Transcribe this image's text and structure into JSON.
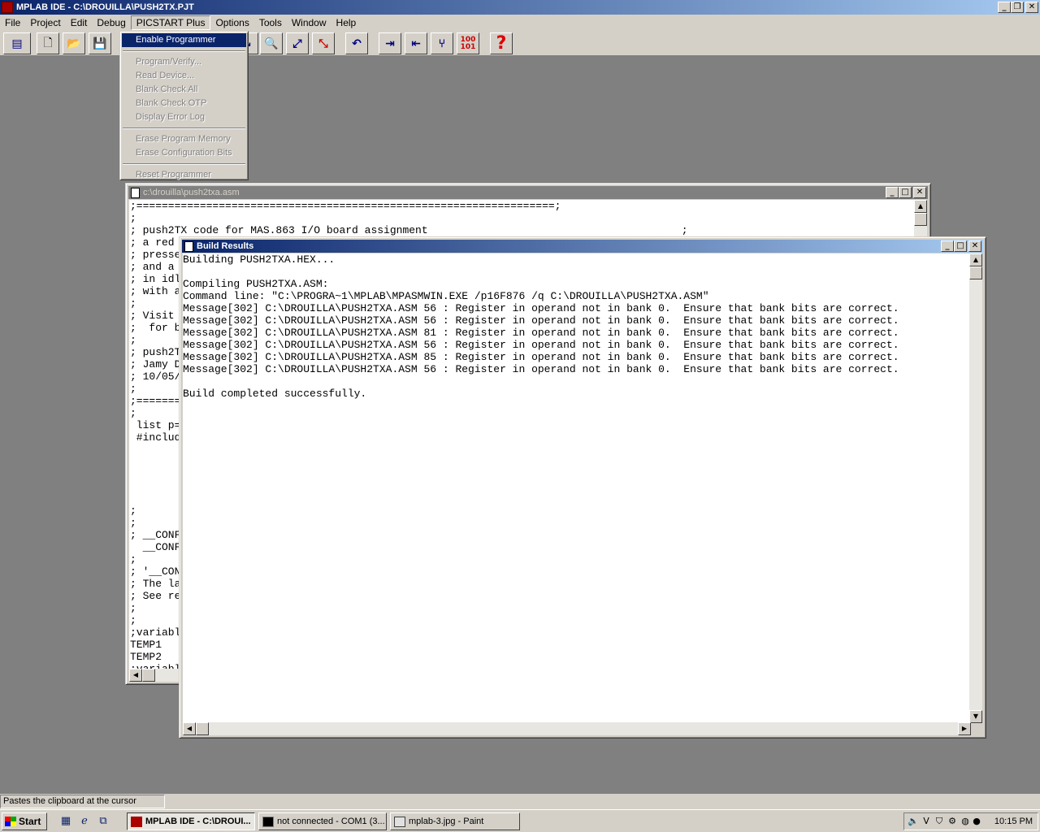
{
  "app": {
    "title": "MPLAB IDE - C:\\DROUILLA\\PUSH2TX.PJT"
  },
  "menubar": {
    "items": [
      "File",
      "Project",
      "Edit",
      "Debug",
      "PICSTART Plus",
      "Options",
      "Tools",
      "Window",
      "Help"
    ],
    "active_index": 4
  },
  "toolbar": {
    "buttons": [
      "project-icon",
      "new-file-icon",
      "open-folder-icon",
      "save-icon",
      "zoom-icon",
      "step-icon",
      "step-over-icon",
      "undo-icon",
      "indent-icon",
      "outdent-icon",
      "branch-icon",
      "hex-ascii-icon",
      "help-icon"
    ]
  },
  "picstart_menu": {
    "items": [
      {
        "label": "Enable Programmer",
        "enabled": true,
        "selected": true
      },
      {
        "separator": true
      },
      {
        "label": "Program/Verify...",
        "enabled": false
      },
      {
        "label": "Read Device...",
        "enabled": false
      },
      {
        "label": "Blank Check All",
        "enabled": false
      },
      {
        "label": "Blank Check OTP",
        "enabled": false
      },
      {
        "label": "Display Error Log",
        "enabled": false
      },
      {
        "separator": true
      },
      {
        "label": "Erase Program Memory",
        "enabled": false
      },
      {
        "label": "Erase Configuration Bits",
        "enabled": false
      },
      {
        "separator": true
      },
      {
        "label": "Reset Programmer",
        "enabled": false
      }
    ]
  },
  "editor": {
    "title": "c:\\drouilla\\push2txa.asm",
    "lines": [
      ";==================================================================;",
      ";",
      "; push2TX code for MAS.863 I/O board assignment                                        ;",
      "; a red",
      "; presse",
      "; and a",
      "; in idl",
      "; with a",
      ";",
      "; Visit",
      ";  for b",
      ";",
      "; push2T",
      "; Jamy D",
      "; 10/05/",
      ";",
      ";=======",
      ";",
      " list p=",
      " #includ",
      "",
      "",
      "",
      "",
      "",
      ";",
      ";",
      "; __CONF",
      "  __CONF",
      ";",
      "; '__CON",
      "; The la",
      "; See re",
      ";",
      ";",
      ";variabl",
      "TEMP1",
      "TEMP2",
      ";variabl"
    ]
  },
  "build_results": {
    "title": "Build Results",
    "lines": [
      "Building PUSH2TXA.HEX...",
      "",
      "Compiling PUSH2TXA.ASM:",
      "Command line: \"C:\\PROGRA~1\\MPLAB\\MPASMWIN.EXE /p16F876 /q C:\\DROUILLA\\PUSH2TXA.ASM\"",
      "Message[302] C:\\DROUILLA\\PUSH2TXA.ASM 56 : Register in operand not in bank 0.  Ensure that bank bits are correct.",
      "Message[302] C:\\DROUILLA\\PUSH2TXA.ASM 56 : Register in operand not in bank 0.  Ensure that bank bits are correct.",
      "Message[302] C:\\DROUILLA\\PUSH2TXA.ASM 81 : Register in operand not in bank 0.  Ensure that bank bits are correct.",
      "Message[302] C:\\DROUILLA\\PUSH2TXA.ASM 56 : Register in operand not in bank 0.  Ensure that bank bits are correct.",
      "Message[302] C:\\DROUILLA\\PUSH2TXA.ASM 85 : Register in operand not in bank 0.  Ensure that bank bits are correct.",
      "Message[302] C:\\DROUILLA\\PUSH2TXA.ASM 56 : Register in operand not in bank 0.  Ensure that bank bits are correct.",
      "",
      "Build completed successfully."
    ]
  },
  "statusbar": {
    "text": "Pastes the clipboard at the cursor position"
  },
  "taskbar": {
    "start_label": "Start",
    "tasks": [
      {
        "label": "MPLAB IDE - C:\\DROUI...",
        "active": true
      },
      {
        "label": "not connected - COM1 (3...",
        "active": false
      },
      {
        "label": "mplab-3.jpg - Paint",
        "active": false
      }
    ],
    "clock": "10:15 PM"
  },
  "colors": {
    "title_active": "#0a246a",
    "title_gradient_end": "#a6caf0",
    "face": "#d4d0c8",
    "desktop": "#808080"
  }
}
